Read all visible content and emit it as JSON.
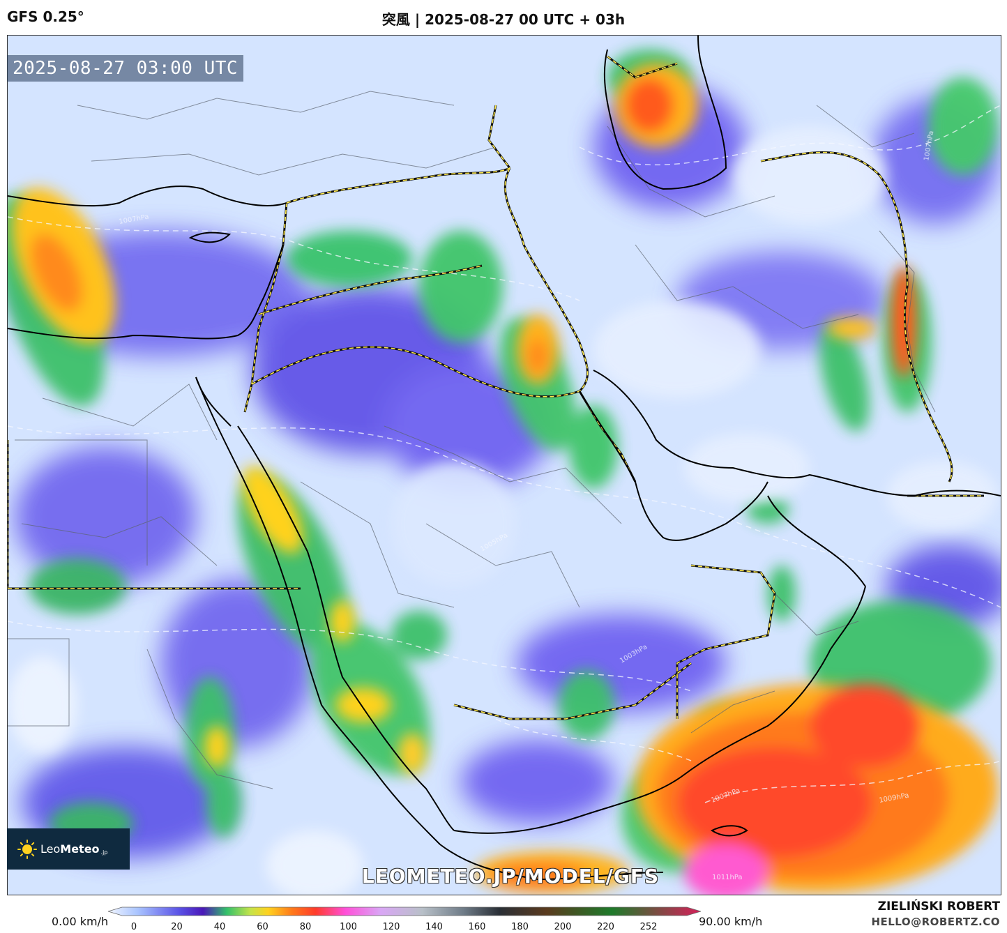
{
  "header": {
    "model": "GFS 0.25°",
    "title": "突風 | 2025-08-27 00 UTC + 03h"
  },
  "map": {
    "timestamp": "2025-08-27 03:00 UTC",
    "watermark": "LEOMETEO.JP/MODEL/GFS",
    "logo": {
      "brand_light": "Leo",
      "brand_bold": "Meteo",
      "tld": ".jp",
      "icon": "sun-icon"
    },
    "isobar_labels": [
      "1007hPa",
      "1005hPa",
      "1007hPa",
      "1003hPa",
      "1009hPa",
      "1007hPa",
      "1011hPa"
    ]
  },
  "legend": {
    "min_label": "0.00 km/h",
    "max_label": "90.00 km/h",
    "ticks": [
      "0",
      "20",
      "40",
      "60",
      "80",
      "100",
      "120",
      "140",
      "160",
      "180",
      "200",
      "220",
      "252"
    ],
    "colors": [
      "#f2f6ff",
      "#a9c4ff",
      "#5a52e6",
      "#4a18b8",
      "#33c06a",
      "#c4e34a",
      "#ffd21f",
      "#ff7a1a",
      "#ff3b2b",
      "#ff4fd8",
      "#d9a6f5",
      "#b8c0c8",
      "#6e7b87",
      "#2a2f36",
      "#5a3a1e",
      "#1e7a2a",
      "#d6205a"
    ]
  },
  "credits": {
    "author": "ZIELIŃSKI ROBERT",
    "email": "HELLO@ROBERTZ.CO"
  }
}
